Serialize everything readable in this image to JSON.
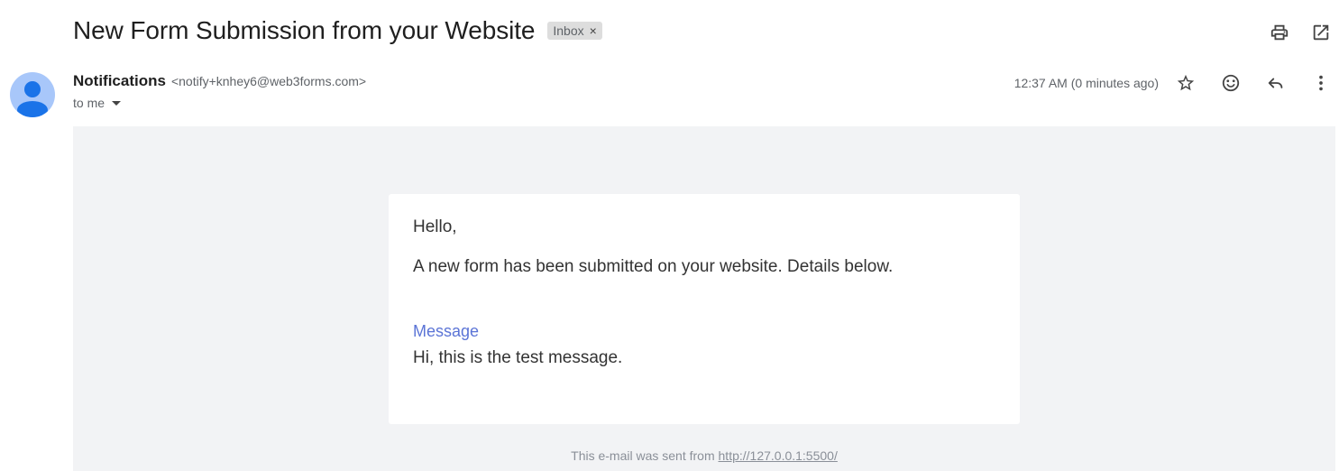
{
  "subject": "New Form Submission from your Website",
  "label_chip": {
    "text": "Inbox",
    "close": "×"
  },
  "top_actions": {
    "print": "print-icon",
    "open_new_window": "open-in-new-icon"
  },
  "sender": {
    "name": "Notifications",
    "email": "<notify+knhey6@web3forms.com>",
    "to_text": "to me"
  },
  "timestamp": "12:37 AM (0 minutes ago)",
  "message_actions": [
    "star-icon",
    "emoji-icon",
    "reply-icon",
    "more-vert-icon"
  ],
  "body": {
    "greeting": "Hello,",
    "intro": "A new form has been submitted on your website. Details below.",
    "field_label": "Message",
    "field_value": "Hi, this is the test message."
  },
  "footer": {
    "text": "This e-mail was sent from ",
    "link": "http://127.0.0.1:5500/"
  },
  "colors": {
    "body_bg": "#f2f3f5",
    "label_blue": "#5b74d6",
    "avatar_bg": "#a8c7fa",
    "avatar_fg": "#1a73e8"
  }
}
